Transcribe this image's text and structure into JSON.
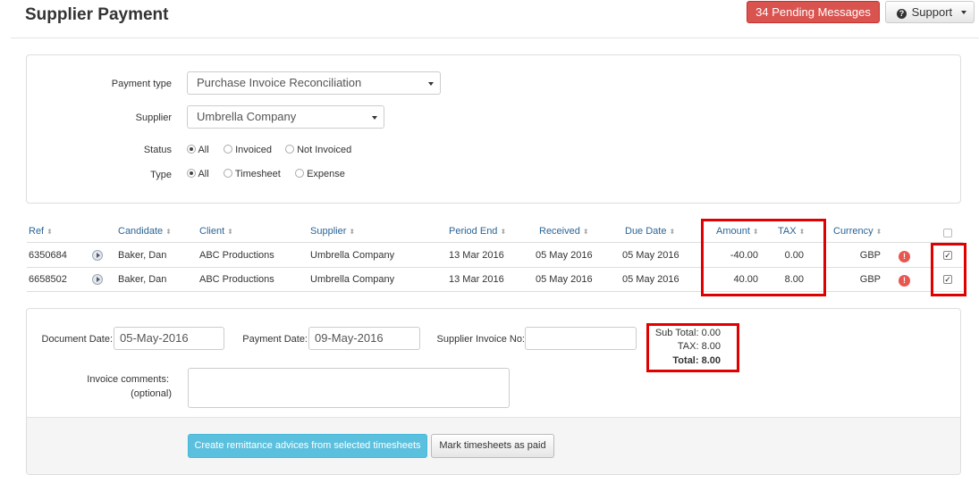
{
  "header": {
    "title": "Supplier Payment",
    "pending_messages": "34 Pending Messages",
    "support_label": "Support"
  },
  "filters": {
    "payment_type_label": "Payment type",
    "payment_type_value": "Purchase Invoice Reconciliation",
    "supplier_label": "Supplier",
    "supplier_value": "Umbrella Company",
    "status_label": "Status",
    "status_options": [
      "All",
      "Invoiced",
      "Not Invoiced"
    ],
    "status_selected": "All",
    "type_label": "Type",
    "type_options": [
      "All",
      "Timesheet",
      "Expense"
    ],
    "type_selected": "All"
  },
  "table": {
    "columns": [
      "Ref",
      "Candidate",
      "Client",
      "Supplier",
      "Period End",
      "Received",
      "Due Date",
      "Amount",
      "TAX",
      "Currency"
    ],
    "rows": [
      {
        "ref": "6350684",
        "candidate": "Baker, Dan",
        "client": "ABC Productions",
        "supplier": "Umbrella Company",
        "period_end": "13 Mar 2016",
        "received": "05 May 2016",
        "due_date": "05 May 2016",
        "amount": "-40.00",
        "tax": "0.00",
        "currency": "GBP",
        "checked": true
      },
      {
        "ref": "6658502",
        "candidate": "Baker, Dan",
        "client": "ABC Productions",
        "supplier": "Umbrella Company",
        "period_end": "13 Mar 2016",
        "received": "05 May 2016",
        "due_date": "05 May 2016",
        "amount": "40.00",
        "tax": "8.00",
        "currency": "GBP",
        "checked": true
      }
    ]
  },
  "form": {
    "document_date_label": "Document Date:",
    "document_date_value": "05-May-2016",
    "payment_date_label": "Payment Date:",
    "payment_date_value": "09-May-2016",
    "supplier_invoice_label": "Supplier Invoice No:",
    "supplier_invoice_value": "",
    "comments_label": "Invoice comments:",
    "comments_optional": "(optional)",
    "subtotal": "Sub Total: 0.00",
    "tax": "TAX: 8.00",
    "total": "Total: 8.00",
    "create_button": "Create remittance advices from selected timesheets",
    "mark_paid_button": "Mark timesheets as paid"
  },
  "colors": {
    "accent": "#2a6496",
    "danger": "#d9534f",
    "info": "#5bc0de",
    "highlight": "#e00000"
  }
}
